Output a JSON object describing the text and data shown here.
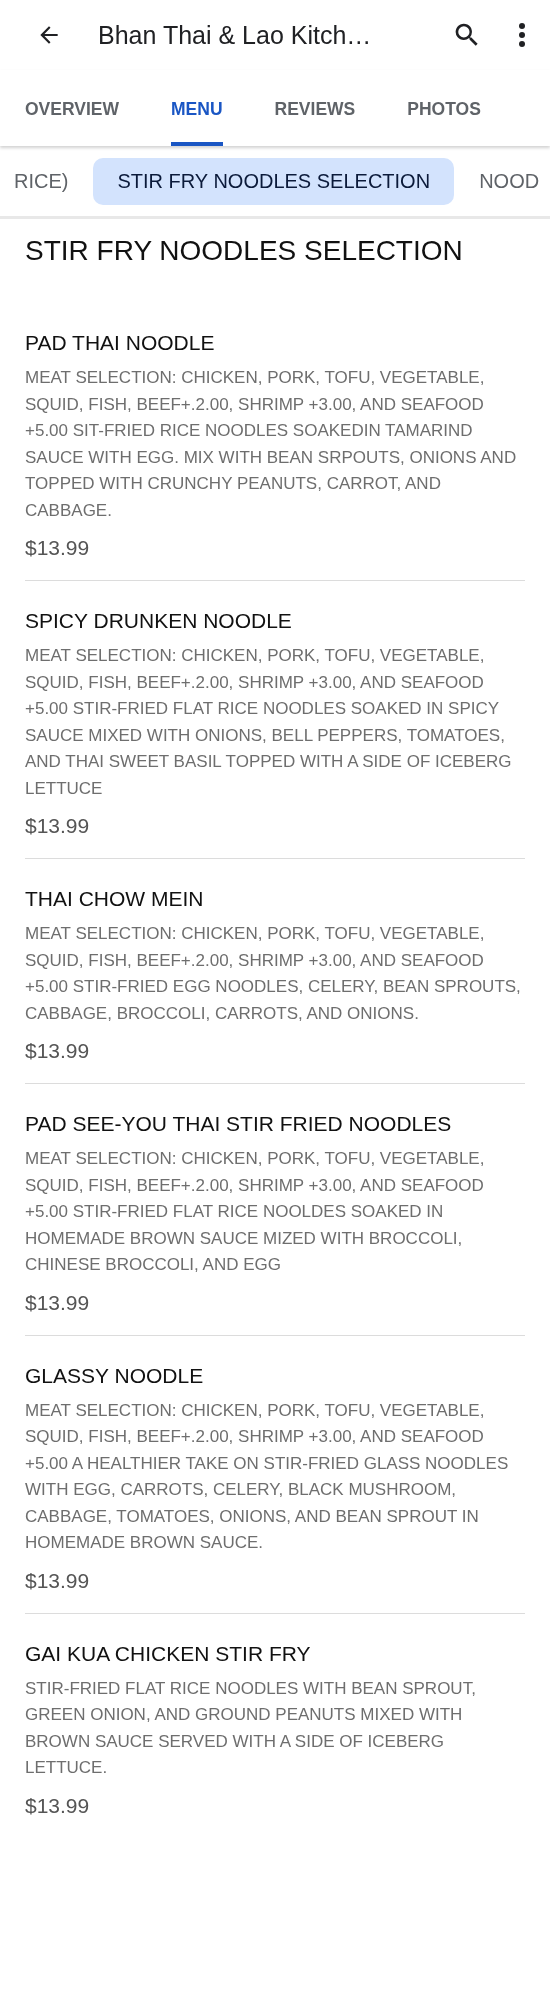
{
  "header": {
    "title": "Bhan Thai & Lao Kitch…"
  },
  "tabs": [
    {
      "label": "OVERVIEW",
      "selected": false
    },
    {
      "label": "MENU",
      "selected": true
    },
    {
      "label": "REVIEWS",
      "selected": false
    },
    {
      "label": "PHOTOS",
      "selected": false
    }
  ],
  "categories": [
    {
      "label": "RICE)",
      "selected": false
    },
    {
      "label": "STIR FRY NOODLES SELECTION",
      "selected": true
    },
    {
      "label": "NOOD",
      "selected": false
    }
  ],
  "section": {
    "title": "STIR FRY NOODLES SELECTION",
    "items": [
      {
        "name": "PAD THAI NOODLE",
        "description": "MEAT SELECTION: CHICKEN, PORK, TOFU, VEGETABLE, SQUID, FISH, BEEF+.2.00, SHRIMP +3.00, AND SEAFOOD +5.00 SIT-FRIED RICE NOODLES SOAKEDIN TAMARIND SAUCE WITH EGG. MIX WITH BEAN SRPOUTS, ONIONS AND TOPPED WITH CRUNCHY PEANUTS, CARROT, AND CABBAGE.",
        "price": "$13.99"
      },
      {
        "name": "SPICY DRUNKEN NOODLE",
        "description": "MEAT SELECTION: CHICKEN, PORK, TOFU, VEGETABLE, SQUID, FISH, BEEF+.2.00, SHRIMP +3.00, AND SEAFOOD +5.00 STIR-FRIED FLAT RICE NOODLES SOAKED IN SPICY SAUCE MIXED WITH ONIONS, BELL PEPPERS, TOMATOES, AND THAI SWEET BASIL TOPPED WITH A SIDE OF ICEBERG LETTUCE",
        "price": "$13.99"
      },
      {
        "name": "THAI CHOW MEIN",
        "description": "MEAT SELECTION: CHICKEN, PORK, TOFU, VEGETABLE, SQUID, FISH, BEEF+.2.00, SHRIMP +3.00, AND SEAFOOD +5.00 STIR-FRIED EGG NOODLES, CELERY, BEAN SPROUTS, CABBAGE, BROCCOLI, CARROTS, AND ONIONS.",
        "price": "$13.99"
      },
      {
        "name": "PAD SEE-YOU THAI STIR FRIED NOODLES",
        "description": "MEAT SELECTION: CHICKEN, PORK, TOFU, VEGETABLE, SQUID, FISH, BEEF+.2.00, SHRIMP +3.00, AND SEAFOOD +5.00 STIR-FRIED FLAT RICE NOOLDES SOAKED IN HOMEMADE BROWN SAUCE MIZED WITH BROCCOLI, CHINESE BROCCOLI, AND EGG",
        "price": "$13.99"
      },
      {
        "name": "GLASSY NOODLE",
        "description": "MEAT SELECTION: CHICKEN, PORK, TOFU, VEGETABLE, SQUID, FISH, BEEF+.2.00, SHRIMP +3.00, AND SEAFOOD +5.00 A HEALTHIER TAKE ON STIR-FRIED GLASS NOODLES WITH EGG, CARROTS, CELERY, BLACK MUSHROOM, CABBAGE, TOMATOES, ONIONS, AND BEAN SPROUT IN HOMEMADE BROWN SAUCE.",
        "price": "$13.99"
      },
      {
        "name": "GAI KUA CHICKEN STIR FRY",
        "description": "STIR-FRIED FLAT RICE NOODLES WITH BEAN SPROUT, GREEN ONION, AND GROUND PEANUTS MIXED WITH BROWN SAUCE SERVED WITH A SIDE OF ICEBERG LETTUCE.",
        "price": "$13.99"
      }
    ]
  }
}
